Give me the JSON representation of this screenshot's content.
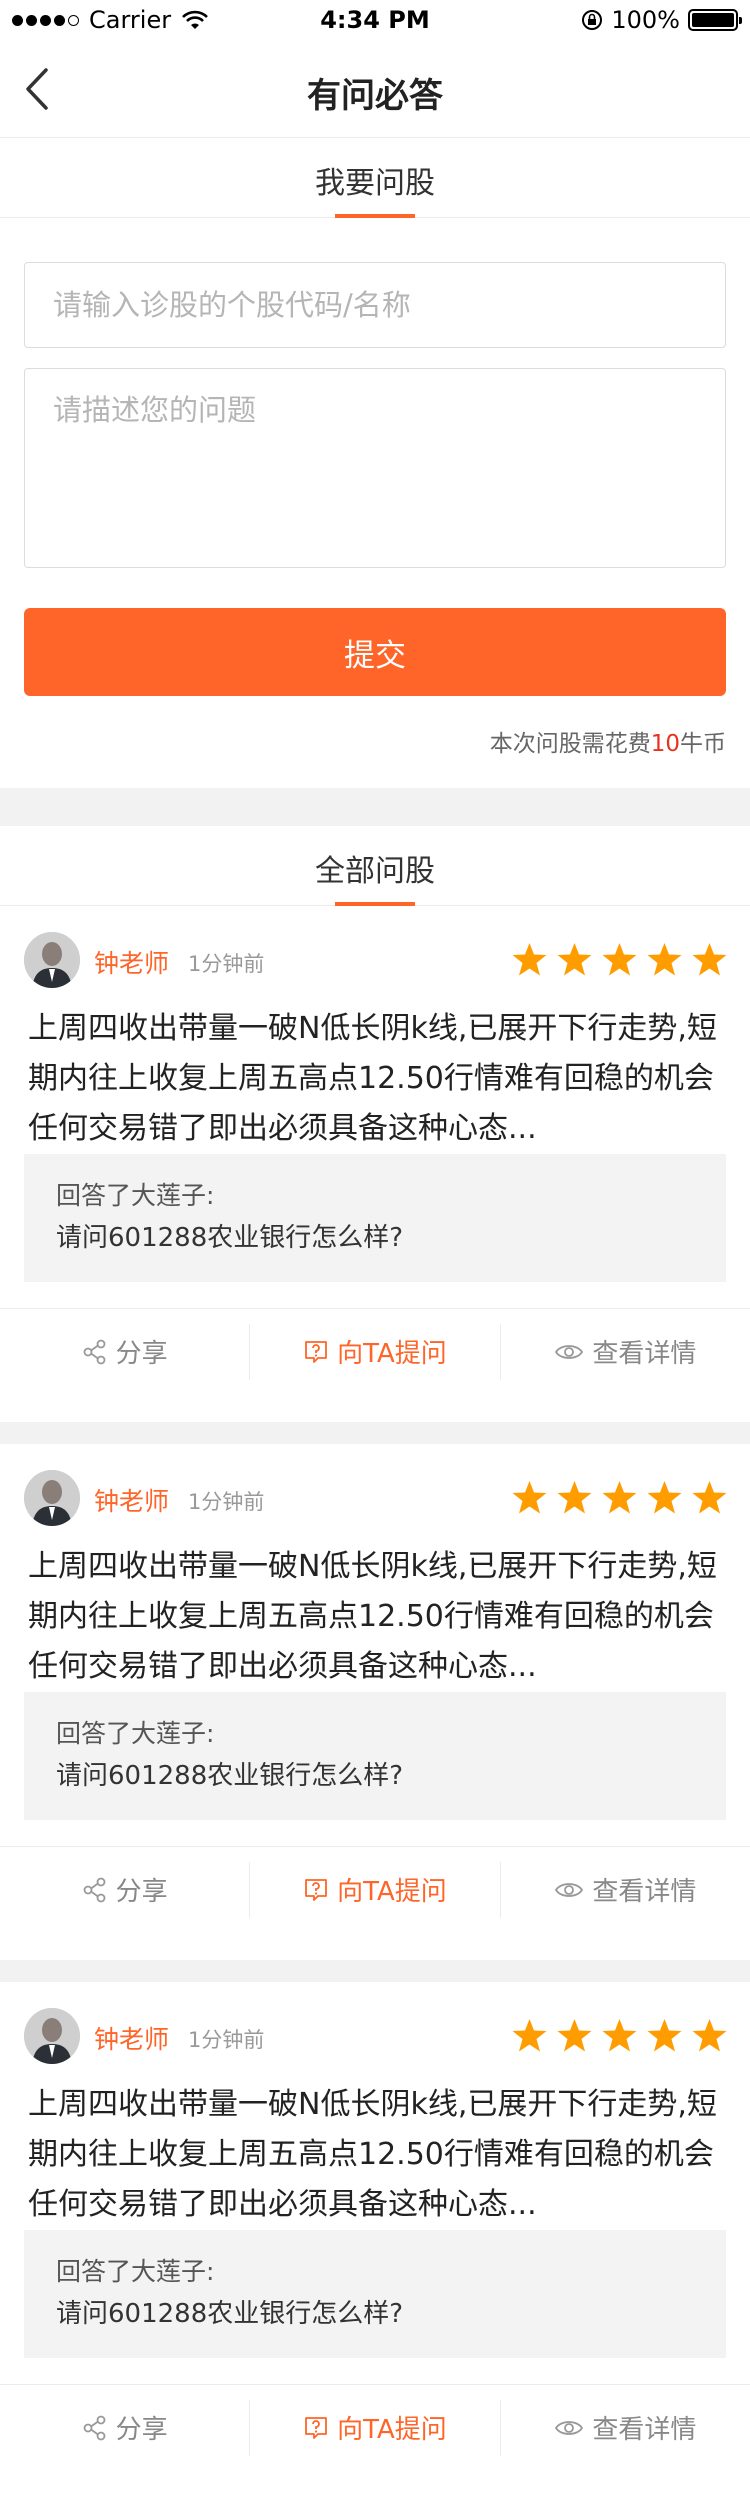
{
  "status_bar": {
    "carrier": "Carrier",
    "time": "4:34 PM",
    "battery": "100%"
  },
  "nav": {
    "title": "有问必答"
  },
  "ask": {
    "tab_label": "我要问股",
    "stock_placeholder": "请输入诊股的个股代码/名称",
    "question_placeholder": "请描述您的问题",
    "submit_label": "提交",
    "cost_prefix": "本次问股需花费",
    "cost_amount": "10",
    "cost_suffix": "牛币"
  },
  "all": {
    "tab_label": "全部问股"
  },
  "colors": {
    "accent": "#ff6528",
    "star": "#ff9c00",
    "price_red": "#e8321e"
  },
  "cards": [
    {
      "teacher": "钟老师",
      "time": "1分钟前",
      "rating": 5,
      "content": "上周四收出带量一破N低长阴k线,已展开下行走势,短期内往上收复上周五高点12.50行情难有回稳的机会任何交易错了即出必须具备这种心态...",
      "answered_to": "回答了大莲子:",
      "question": "请问601288农业银行怎么样?",
      "share": "分享",
      "ask_ta": "向TA提问",
      "details": "查看详情"
    },
    {
      "teacher": "钟老师",
      "time": "1分钟前",
      "rating": 5,
      "content": "上周四收出带量一破N低长阴k线,已展开下行走势,短期内往上收复上周五高点12.50行情难有回稳的机会任何交易错了即出必须具备这种心态...",
      "answered_to": "回答了大莲子:",
      "question": "请问601288农业银行怎么样?",
      "share": "分享",
      "ask_ta": "向TA提问",
      "details": "查看详情"
    },
    {
      "teacher": "钟老师",
      "time": "1分钟前",
      "rating": 5,
      "content": "上周四收出带量一破N低长阴k线,已展开下行走势,短期内往上收复上周五高点12.50行情难有回稳的机会任何交易错了即出必须具备这种心态...",
      "answered_to": "回答了大莲子:",
      "question": "请问601288农业银行怎么样?",
      "share": "分享",
      "ask_ta": "向TA提问",
      "details": "查看详情"
    }
  ]
}
